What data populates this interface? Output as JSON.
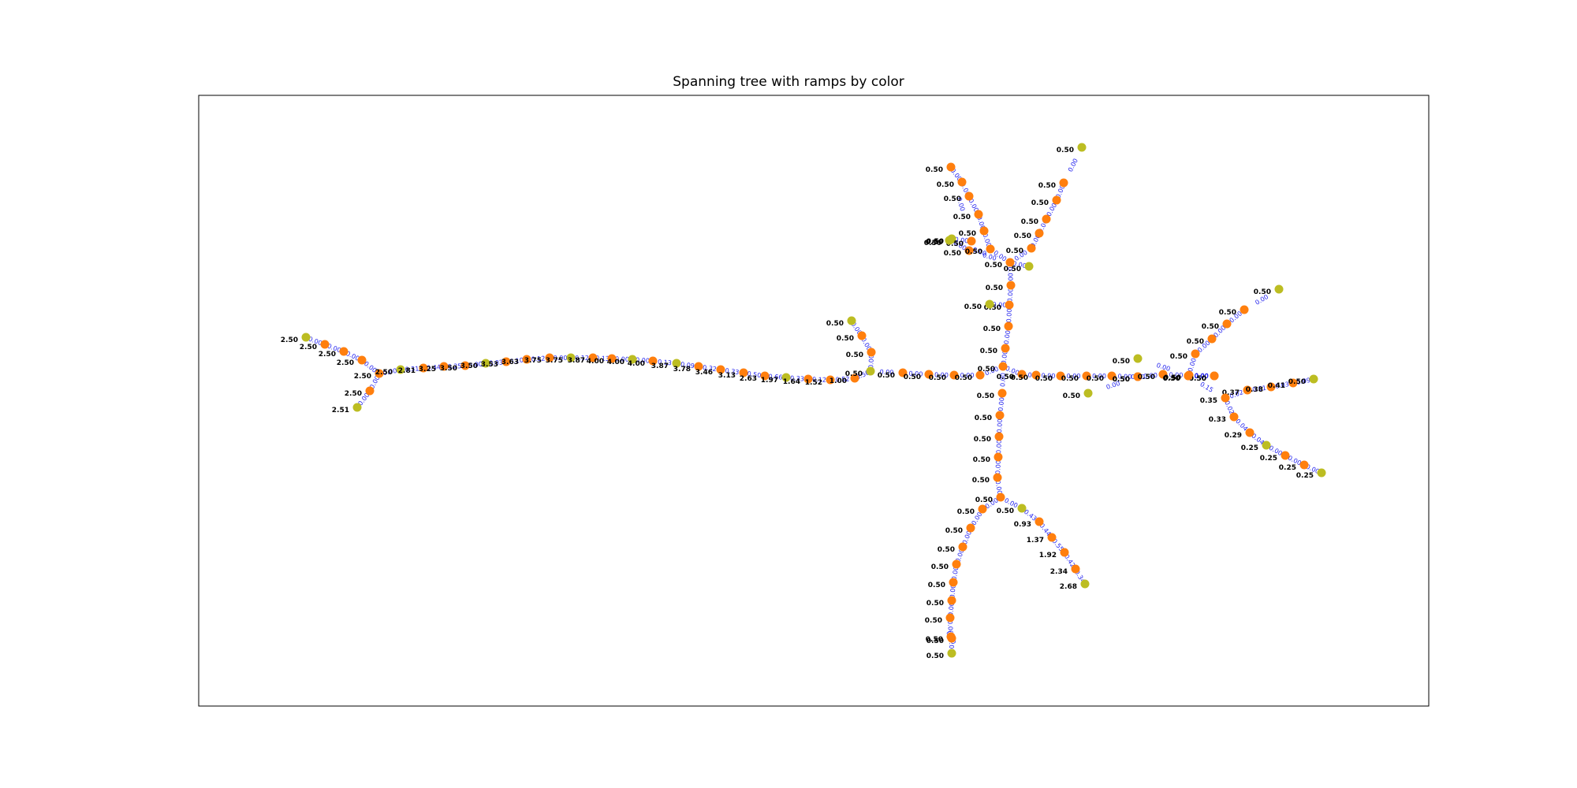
{
  "title": "Spanning tree with ramps by color",
  "colors": {
    "node_orange": "#ff7f0e",
    "node_olive": "#bcbd22",
    "edge_label": "#2222ee",
    "node_label": "#000000",
    "frame": "#000000"
  },
  "nodes": [
    {
      "id": "L0",
      "value": "2.50",
      "type": "olive"
    },
    {
      "id": "L1",
      "value": "2.50",
      "type": "orange"
    },
    {
      "id": "L2",
      "value": "2.50",
      "type": "orange"
    },
    {
      "id": "L3",
      "value": "2.50",
      "type": "orange"
    },
    {
      "id": "L4",
      "value": "2.50",
      "type": "orange"
    },
    {
      "id": "L5",
      "value": "2.50",
      "type": "orange"
    },
    {
      "id": "L6",
      "value": "2.51",
      "type": "olive"
    },
    {
      "id": "M0",
      "value": "2.50",
      "type": "olive"
    },
    {
      "id": "M1",
      "value": "2.81",
      "type": "orange"
    },
    {
      "id": "M2",
      "value": "3.25",
      "type": "orange"
    },
    {
      "id": "M3",
      "value": "3.50",
      "type": "orange"
    },
    {
      "id": "M4",
      "value": "3.50",
      "type": "olive"
    },
    {
      "id": "M5",
      "value": "3.53",
      "type": "orange"
    },
    {
      "id": "M6",
      "value": "3.63",
      "type": "orange"
    },
    {
      "id": "M7",
      "value": "3.75",
      "type": "orange"
    },
    {
      "id": "M8",
      "value": "3.75",
      "type": "olive"
    },
    {
      "id": "M9",
      "value": "3.87",
      "type": "orange"
    },
    {
      "id": "M10",
      "value": "4.00",
      "type": "orange"
    },
    {
      "id": "M11",
      "value": "4.00",
      "type": "olive"
    },
    {
      "id": "M12",
      "value": "4.00",
      "type": "orange"
    },
    {
      "id": "M13",
      "value": "3.87",
      "type": "olive"
    },
    {
      "id": "M14",
      "value": "3.78",
      "type": "orange"
    },
    {
      "id": "M15",
      "value": "3.46",
      "type": "orange"
    },
    {
      "id": "M16",
      "value": "3.13",
      "type": "orange"
    },
    {
      "id": "M17",
      "value": "2.63",
      "type": "orange"
    },
    {
      "id": "M18",
      "value": "1.97",
      "type": "olive"
    },
    {
      "id": "M19",
      "value": "1.64",
      "type": "orange"
    },
    {
      "id": "M20",
      "value": "1.52",
      "type": "orange"
    },
    {
      "id": "M21",
      "value": "1.00",
      "type": "orange"
    },
    {
      "id": "J1",
      "value": "0.50",
      "type": "olive"
    },
    {
      "id": "B1",
      "value": "0.50",
      "type": "olive"
    },
    {
      "id": "B2",
      "value": "0.50",
      "type": "orange"
    },
    {
      "id": "B3",
      "value": "0.50",
      "type": "orange"
    },
    {
      "id": "E1",
      "value": "0.50",
      "type": "orange"
    },
    {
      "id": "E2",
      "value": "0.50",
      "type": "orange"
    },
    {
      "id": "E3",
      "value": "0.50",
      "type": "orange"
    },
    {
      "id": "E4",
      "value": "0.50",
      "type": "orange"
    },
    {
      "id": "C",
      "value": "0.50",
      "type": "orange"
    },
    {
      "id": "C2",
      "value": "0.50",
      "type": "orange"
    },
    {
      "id": "U1",
      "value": "0.50",
      "type": "orange"
    },
    {
      "id": "U2",
      "value": "0.50",
      "type": "orange"
    },
    {
      "id": "U3",
      "value": "0.50",
      "type": "orange"
    },
    {
      "id": "U4",
      "value": "0.50",
      "type": "olive"
    },
    {
      "id": "U5",
      "value": "0.50",
      "type": "orange"
    },
    {
      "id": "UA",
      "value": "0.50",
      "type": "olive"
    },
    {
      "id": "J2",
      "value": "0.50",
      "type": "orange"
    },
    {
      "id": "P0",
      "value": "0.50",
      "type": "olive"
    },
    {
      "id": "P1",
      "value": "0.50",
      "type": "orange"
    },
    {
      "id": "P2",
      "value": "0.50",
      "type": "orange"
    },
    {
      "id": "P3",
      "value": "0.50",
      "type": "orange"
    },
    {
      "id": "P4",
      "value": "0.50",
      "type": "orange"
    },
    {
      "id": "P5",
      "value": "0.50",
      "type": "orange"
    },
    {
      "id": "Q1",
      "value": "0.50",
      "type": "olive"
    },
    {
      "id": "Q2",
      "value": "0.50",
      "type": "orange"
    },
    {
      "id": "R0",
      "value": "0.50",
      "type": "olive"
    },
    {
      "id": "R1",
      "value": "0.50",
      "type": "orange"
    },
    {
      "id": "R2",
      "value": "0.50",
      "type": "orange"
    },
    {
      "id": "R3",
      "value": "0.50",
      "type": "orange"
    },
    {
      "id": "R4",
      "value": "0.50",
      "type": "orange"
    },
    {
      "id": "R5",
      "value": "0.50",
      "type": "orange"
    },
    {
      "id": "R6",
      "value": "0.50",
      "type": "orange"
    },
    {
      "id": "R7",
      "value": "0.50",
      "type": "orange"
    },
    {
      "id": "RG",
      "value": "0.50",
      "type": "olive"
    },
    {
      "id": "W1",
      "value": "0.50",
      "type": "orange"
    },
    {
      "id": "W2",
      "value": "0.50",
      "type": "orange"
    },
    {
      "id": "W3",
      "value": "0.50",
      "type": "orange"
    },
    {
      "id": "W4",
      "value": "0.50",
      "type": "orange"
    },
    {
      "id": "W5",
      "value": "0.50",
      "type": "orange"
    },
    {
      "id": "W6",
      "value": "0.50",
      "type": "orange"
    },
    {
      "id": "W7",
      "value": "0.50",
      "type": "orange"
    },
    {
      "id": "W8",
      "value": "0.50",
      "type": "orange"
    },
    {
      "id": "W9",
      "value": "0.50",
      "type": "orange"
    },
    {
      "id": "W10",
      "value": "0.50",
      "type": "orange"
    },
    {
      "id": "W11",
      "value": "0.50",
      "type": "orange"
    },
    {
      "id": "X1",
      "value": "0.50",
      "type": "olive"
    },
    {
      "id": "X2",
      "value": "0.50",
      "type": "olive"
    },
    {
      "id": "J3",
      "value": "0.50",
      "type": "orange"
    },
    {
      "id": "T1",
      "value": "0.50",
      "type": "orange"
    },
    {
      "id": "T2",
      "value": "0.50",
      "type": "orange"
    },
    {
      "id": "T3",
      "value": "0.50",
      "type": "orange"
    },
    {
      "id": "T4",
      "value": "0.50",
      "type": "orange"
    },
    {
      "id": "T5",
      "value": "0.50",
      "type": "olive"
    },
    {
      "id": "S1",
      "value": "0.37",
      "type": "orange"
    },
    {
      "id": "S2",
      "value": "0.38",
      "type": "orange"
    },
    {
      "id": "S3",
      "value": "0.41",
      "type": "orange"
    },
    {
      "id": "S4",
      "value": "0.50",
      "type": "olive"
    },
    {
      "id": "V1",
      "value": "0.35",
      "type": "orange"
    },
    {
      "id": "V2",
      "value": "0.33",
      "type": "orange"
    },
    {
      "id": "V3",
      "value": "0.29",
      "type": "orange"
    },
    {
      "id": "V4",
      "value": "0.25",
      "type": "olive"
    },
    {
      "id": "V5",
      "value": "0.25",
      "type": "orange"
    },
    {
      "id": "V6",
      "value": "0.25",
      "type": "orange"
    },
    {
      "id": "V7",
      "value": "0.25",
      "type": "olive"
    },
    {
      "id": "D1",
      "value": "0.50",
      "type": "orange"
    },
    {
      "id": "D2",
      "value": "0.50",
      "type": "orange"
    },
    {
      "id": "D3",
      "value": "0.50",
      "type": "orange"
    },
    {
      "id": "D4",
      "value": "0.50",
      "type": "orange"
    },
    {
      "id": "D5",
      "value": "0.50",
      "type": "orange"
    },
    {
      "id": "D6",
      "value": "0.50",
      "type": "orange"
    },
    {
      "id": "F1",
      "value": "0.50",
      "type": "orange"
    },
    {
      "id": "F2",
      "value": "0.50",
      "type": "orange"
    },
    {
      "id": "F3",
      "value": "0.50",
      "type": "orange"
    },
    {
      "id": "F4",
      "value": "0.50",
      "type": "orange"
    },
    {
      "id": "F5",
      "value": "0.50",
      "type": "orange"
    },
    {
      "id": "F6",
      "value": "0.50",
      "type": "orange"
    },
    {
      "id": "F7",
      "value": "0.50",
      "type": "orange"
    },
    {
      "id": "F8",
      "value": "0.50",
      "type": "orange"
    },
    {
      "id": "F9",
      "value": "0.50",
      "type": "orange"
    },
    {
      "id": "F10",
      "value": "0.50",
      "type": "olive"
    },
    {
      "id": "G1",
      "value": "0.50",
      "type": "olive"
    },
    {
      "id": "G2",
      "value": "0.93",
      "type": "orange"
    },
    {
      "id": "G3",
      "value": "1.37",
      "type": "orange"
    },
    {
      "id": "G4",
      "value": "1.92",
      "type": "orange"
    },
    {
      "id": "G5",
      "value": "2.34",
      "type": "orange"
    },
    {
      "id": "G6",
      "value": "2.68",
      "type": "olive"
    }
  ],
  "edges": [
    {
      "a": "L0",
      "b": "L1",
      "label": "0.00"
    },
    {
      "a": "L1",
      "b": "L2",
      "label": "0.00"
    },
    {
      "a": "L2",
      "b": "L3",
      "label": "0.00"
    },
    {
      "a": "L3",
      "b": "L4",
      "label": "0.00"
    },
    {
      "a": "L4",
      "b": "L5",
      "label": "0.00"
    },
    {
      "a": "L5",
      "b": "L6",
      "label": "0.00"
    },
    {
      "a": "L4",
      "b": "M0",
      "label": "0.00"
    },
    {
      "a": "M0",
      "b": "M1",
      "label": "0.31"
    },
    {
      "a": "M1",
      "b": "M2",
      "label": "0.44"
    },
    {
      "a": "M2",
      "b": "M3",
      "label": "0.25"
    },
    {
      "a": "M3",
      "b": "M4",
      "label": "0.00"
    },
    {
      "a": "M4",
      "b": "M5",
      "label": "0.03"
    },
    {
      "a": "M5",
      "b": "M6",
      "label": "0.10"
    },
    {
      "a": "M6",
      "b": "M7",
      "label": "0.12"
    },
    {
      "a": "M7",
      "b": "M8",
      "label": "0.00"
    },
    {
      "a": "M8",
      "b": "M9",
      "label": "0.12"
    },
    {
      "a": "M9",
      "b": "M10",
      "label": "0.13"
    },
    {
      "a": "M10",
      "b": "M11",
      "label": "0.00"
    },
    {
      "a": "M11",
      "b": "M12",
      "label": "0.00"
    },
    {
      "a": "M12",
      "b": "M13",
      "label": "0.13"
    },
    {
      "a": "M13",
      "b": "M14",
      "label": "0.09"
    },
    {
      "a": "M14",
      "b": "M15",
      "label": "0.32"
    },
    {
      "a": "M15",
      "b": "M16",
      "label": "0.33"
    },
    {
      "a": "M16",
      "b": "M17",
      "label": "0.50"
    },
    {
      "a": "M17",
      "b": "M18",
      "label": "0.66"
    },
    {
      "a": "M18",
      "b": "M19",
      "label": "0.33"
    },
    {
      "a": "M19",
      "b": "M20",
      "label": "0.12"
    },
    {
      "a": "M20",
      "b": "M21",
      "label": "0.52"
    },
    {
      "a": "M21",
      "b": "J1",
      "label": "0.50"
    },
    {
      "a": "J1",
      "b": "B3",
      "label": "0.00"
    },
    {
      "a": "B3",
      "b": "B2",
      "label": "0.00"
    },
    {
      "a": "B2",
      "b": "B1",
      "label": "0.00"
    },
    {
      "a": "J1",
      "b": "E1",
      "label": "0.00"
    },
    {
      "a": "E1",
      "b": "E2",
      "label": "0.00"
    },
    {
      "a": "E2",
      "b": "E3",
      "label": "0.00"
    },
    {
      "a": "E3",
      "b": "E4",
      "label": "0.00"
    },
    {
      "a": "E4",
      "b": "C",
      "label": "0.00"
    },
    {
      "a": "C",
      "b": "C2",
      "label": "0.00"
    },
    {
      "a": "C",
      "b": "U1",
      "label": "0.00"
    },
    {
      "a": "U1",
      "b": "U2",
      "label": "0.00"
    },
    {
      "a": "U2",
      "b": "U3",
      "label": "0.00"
    },
    {
      "a": "U3",
      "b": "U4",
      "label": "0.00"
    },
    {
      "a": "U3",
      "b": "U5",
      "label": "0.00"
    },
    {
      "a": "U5",
      "b": "J2",
      "label": "0.00"
    },
    {
      "a": "J2",
      "b": "UA",
      "label": "0.00"
    },
    {
      "a": "J2",
      "b": "P5",
      "label": "0.00"
    },
    {
      "a": "P5",
      "b": "P4",
      "label": "0.00"
    },
    {
      "a": "P4",
      "b": "P3",
      "label": "0.00"
    },
    {
      "a": "P3",
      "b": "P2",
      "label": "0.00"
    },
    {
      "a": "P2",
      "b": "P1",
      "label": "0.00"
    },
    {
      "a": "P1",
      "b": "P0",
      "label": "0.00"
    },
    {
      "a": "J2",
      "b": "Q2",
      "label": "0.00"
    },
    {
      "a": "Q2",
      "b": "Q1",
      "label": "0.00"
    },
    {
      "a": "J2",
      "b": "R7",
      "label": "0.00"
    },
    {
      "a": "R7",
      "b": "R6",
      "label": "0.00"
    },
    {
      "a": "R6",
      "b": "R5",
      "label": "0.00"
    },
    {
      "a": "R5",
      "b": "R4",
      "label": "0.00"
    },
    {
      "a": "R4",
      "b": "R3",
      "label": "0.00"
    },
    {
      "a": "R3",
      "b": "R2",
      "label": "0.00"
    },
    {
      "a": "R2",
      "b": "R1",
      "label": "0.00"
    },
    {
      "a": "R1",
      "b": "R0",
      "label": "0.00"
    },
    {
      "a": "J2",
      "b": "RG",
      "label": "0.00"
    },
    {
      "a": "C2",
      "b": "W1",
      "label": "0.00"
    },
    {
      "a": "W1",
      "b": "W2",
      "label": "0.00"
    },
    {
      "a": "W2",
      "b": "W3",
      "label": "0.00"
    },
    {
      "a": "W3",
      "b": "W4",
      "label": "0.00"
    },
    {
      "a": "W4",
      "b": "W5",
      "label": "0.00"
    },
    {
      "a": "W5",
      "b": "W6",
      "label": "0.00"
    },
    {
      "a": "W6",
      "b": "X2",
      "label": "0.00"
    },
    {
      "a": "W6",
      "b": "W7",
      "label": "0.00"
    },
    {
      "a": "W7",
      "b": "W8",
      "label": "0.00"
    },
    {
      "a": "W8",
      "b": "X1",
      "label": "0.00"
    },
    {
      "a": "W8",
      "b": "W9",
      "label": "0.00"
    },
    {
      "a": "W9",
      "b": "W10",
      "label": "0.00"
    },
    {
      "a": "W10",
      "b": "W11",
      "label": "0.00"
    },
    {
      "a": "W11",
      "b": "J3",
      "label": "0.00"
    },
    {
      "a": "J3",
      "b": "T1",
      "label": "0.00"
    },
    {
      "a": "T1",
      "b": "T2",
      "label": "0.00"
    },
    {
      "a": "T2",
      "b": "T3",
      "label": "0.00"
    },
    {
      "a": "T3",
      "b": "T4",
      "label": "0.00"
    },
    {
      "a": "T4",
      "b": "T5",
      "label": "0.00"
    },
    {
      "a": "J3",
      "b": "V1",
      "label": "0.15"
    },
    {
      "a": "V1",
      "b": "S1",
      "label": "0.02"
    },
    {
      "a": "S1",
      "b": "S2",
      "label": "0.01"
    },
    {
      "a": "S2",
      "b": "S3",
      "label": "0.03"
    },
    {
      "a": "S3",
      "b": "S4",
      "label": "0.09"
    },
    {
      "a": "V1",
      "b": "V2",
      "label": "0.02"
    },
    {
      "a": "V2",
      "b": "V3",
      "label": "0.04"
    },
    {
      "a": "V3",
      "b": "V4",
      "label": "0.04"
    },
    {
      "a": "V4",
      "b": "V5",
      "label": "0.00"
    },
    {
      "a": "V5",
      "b": "V6",
      "label": "0.00"
    },
    {
      "a": "V6",
      "b": "V7",
      "label": "0.00"
    },
    {
      "a": "C",
      "b": "D1",
      "label": "0.00"
    },
    {
      "a": "D1",
      "b": "D2",
      "label": "0.00"
    },
    {
      "a": "D2",
      "b": "D3",
      "label": "0.00"
    },
    {
      "a": "D3",
      "b": "D4",
      "label": "0.00"
    },
    {
      "a": "D4",
      "b": "D5",
      "label": "0.00"
    },
    {
      "a": "D5",
      "b": "D6",
      "label": "0.00"
    },
    {
      "a": "D6",
      "b": "F1",
      "label": "0.00"
    },
    {
      "a": "F1",
      "b": "F2",
      "label": "0.00"
    },
    {
      "a": "F2",
      "b": "F3",
      "label": "0.00"
    },
    {
      "a": "F3",
      "b": "F4",
      "label": "0.00"
    },
    {
      "a": "F4",
      "b": "F5",
      "label": "0.00"
    },
    {
      "a": "F5",
      "b": "F6",
      "label": "0.00"
    },
    {
      "a": "F6",
      "b": "F7",
      "label": "0.00"
    },
    {
      "a": "F7",
      "b": "F8",
      "label": "0.00"
    },
    {
      "a": "F8",
      "b": "F9",
      "label": "0.00"
    },
    {
      "a": "F9",
      "b": "F10",
      "label": "0.00"
    },
    {
      "a": "D6",
      "b": "G1",
      "label": "0.00"
    },
    {
      "a": "G1",
      "b": "G2",
      "label": "0.43"
    },
    {
      "a": "G2",
      "b": "G3",
      "label": "0.44"
    },
    {
      "a": "G3",
      "b": "G4",
      "label": "0.55"
    },
    {
      "a": "G4",
      "b": "G5",
      "label": "0.42"
    },
    {
      "a": "G5",
      "b": "G6",
      "label": "0.34"
    }
  ]
}
